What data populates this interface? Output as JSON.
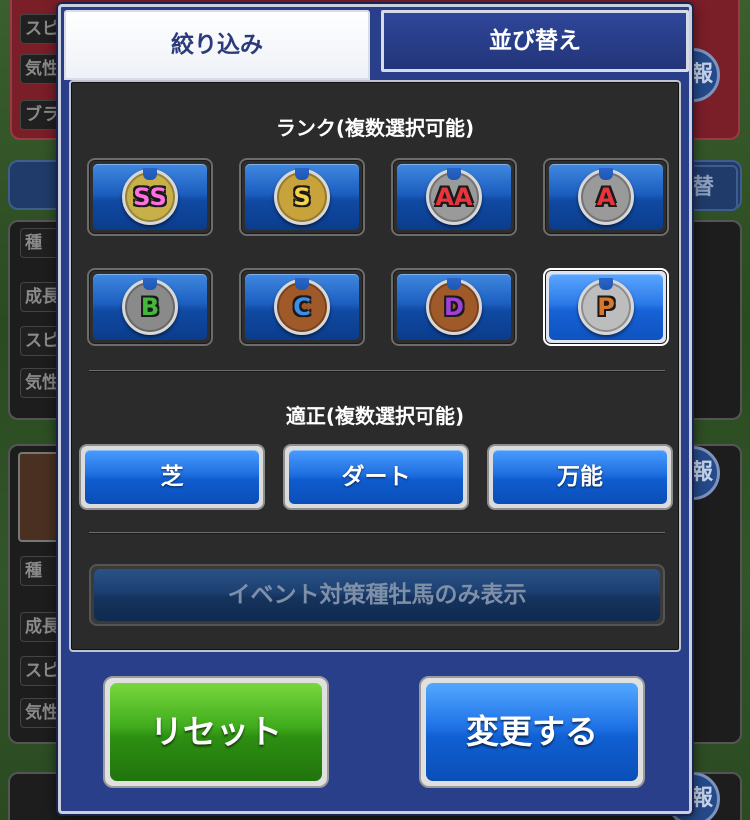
{
  "tabs": {
    "filter": "絞り込み",
    "sort": "並び替え"
  },
  "rank_section": {
    "title": "ランク(複数選択可能)",
    "ranks": [
      {
        "label": "SS",
        "shoe_color": "#c7b04a",
        "letter_color": "#ff6fe0",
        "selected": false
      },
      {
        "label": "S",
        "shoe_color": "#c8a23a",
        "letter_color": "#f5d24a",
        "selected": false
      },
      {
        "label": "AA",
        "shoe_color": "#9a9a9a",
        "letter_color": "#e8343c",
        "selected": false
      },
      {
        "label": "A",
        "shoe_color": "#9a9a9a",
        "letter_color": "#e8343c",
        "selected": false
      },
      {
        "label": "B",
        "shoe_color": "#8a8a8a",
        "letter_color": "#44b83c",
        "selected": false
      },
      {
        "label": "C",
        "shoe_color": "#a05a2a",
        "letter_color": "#3d8ee8",
        "selected": false
      },
      {
        "label": "D",
        "shoe_color": "#a05a2a",
        "letter_color": "#a040d8",
        "selected": false
      },
      {
        "label": "P",
        "shoe_color": "#bdbdbd",
        "letter_color": "#d8782a",
        "selected": true
      }
    ]
  },
  "aptitude_section": {
    "title": "適正(複数選択可能)",
    "options": [
      "芝",
      "ダート",
      "万能"
    ]
  },
  "event_button": "イベント対策種牡馬のみ表示",
  "buttons": {
    "reset": "リセット",
    "change": "変更する"
  },
  "background": {
    "stats": [
      "スピ",
      "気性",
      "ブラ",
      "種",
      "成長",
      "スピ",
      "気性",
      "種",
      "成長",
      "スピ",
      "気性"
    ],
    "right_labels": [
      "切替"
    ],
    "badge": "報"
  }
}
